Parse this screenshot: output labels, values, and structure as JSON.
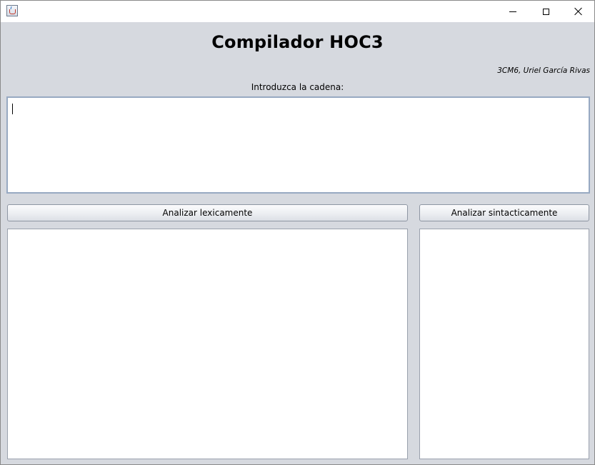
{
  "window": {
    "title": "",
    "icon": "java-cup-icon",
    "controls": {
      "minimize": "minimize-icon",
      "maximize": "maximize-icon",
      "close": "close-icon"
    }
  },
  "header": {
    "title": "Compilador HOC3",
    "author": "3CM6, Uriel García Rivas"
  },
  "input": {
    "label": "Introduzca la cadena:",
    "value": ""
  },
  "actions": {
    "lexical_label": "Analizar lexicamente",
    "syntactic_label": "Analizar sintacticamente"
  },
  "output": {
    "lexical_result": "",
    "syntactic_result": ""
  },
  "colors": {
    "window_background": "#d6d9df",
    "input_border": "#97a9c2"
  }
}
